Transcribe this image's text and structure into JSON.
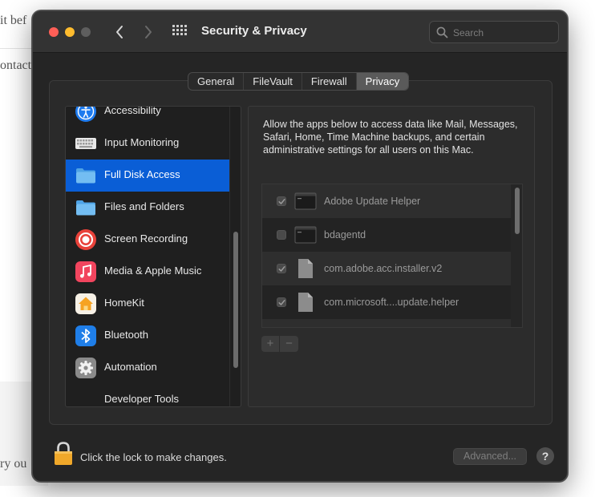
{
  "background": {
    "fragments": [
      "it bef",
      "ontact",
      "ry ou"
    ]
  },
  "window": {
    "title": "Security & Privacy",
    "search_placeholder": "Search"
  },
  "tabs": [
    {
      "label": "General"
    },
    {
      "label": "FileVault"
    },
    {
      "label": "Firewall"
    },
    {
      "label": "Privacy",
      "active": true
    }
  ],
  "sidebar": {
    "items": [
      {
        "label": "Accessibility",
        "icon": "accessibility-icon"
      },
      {
        "label": "Input Monitoring",
        "icon": "keyboard-icon"
      },
      {
        "label": "Full Disk Access",
        "icon": "folder-icon",
        "selected": true
      },
      {
        "label": "Files and Folders",
        "icon": "folder-icon"
      },
      {
        "label": "Screen Recording",
        "icon": "screen-recording-icon"
      },
      {
        "label": "Media & Apple Music",
        "icon": "music-icon"
      },
      {
        "label": "HomeKit",
        "icon": "homekit-icon"
      },
      {
        "label": "Bluetooth",
        "icon": "bluetooth-icon"
      },
      {
        "label": "Automation",
        "icon": "gear-icon"
      },
      {
        "label": "Developer Tools",
        "icon": "none"
      }
    ]
  },
  "detail": {
    "description": "Allow the apps below to access data like Mail, Messages, Safari, Home, Time Machine backups, and certain administrative settings for all users on this Mac.",
    "apps": [
      {
        "name": "Adobe Update Helper",
        "checked": true,
        "icon": "terminal-icon"
      },
      {
        "name": "bdagentd",
        "checked": false,
        "icon": "terminal-icon"
      },
      {
        "name": "com.adobe.acc.installer.v2",
        "checked": true,
        "icon": "document-icon"
      },
      {
        "name": "com.microsoft....update.helper",
        "checked": true,
        "icon": "document-icon"
      }
    ],
    "add_label": "+",
    "remove_label": "−"
  },
  "footer": {
    "lock_text": "Click the lock to make changes.",
    "advanced_label": "Advanced...",
    "help_label": "?"
  },
  "colors": {
    "selection": "#0a5ed6",
    "window_bg": "#252525",
    "close": "#ff5f57",
    "minimize": "#febc2e"
  }
}
